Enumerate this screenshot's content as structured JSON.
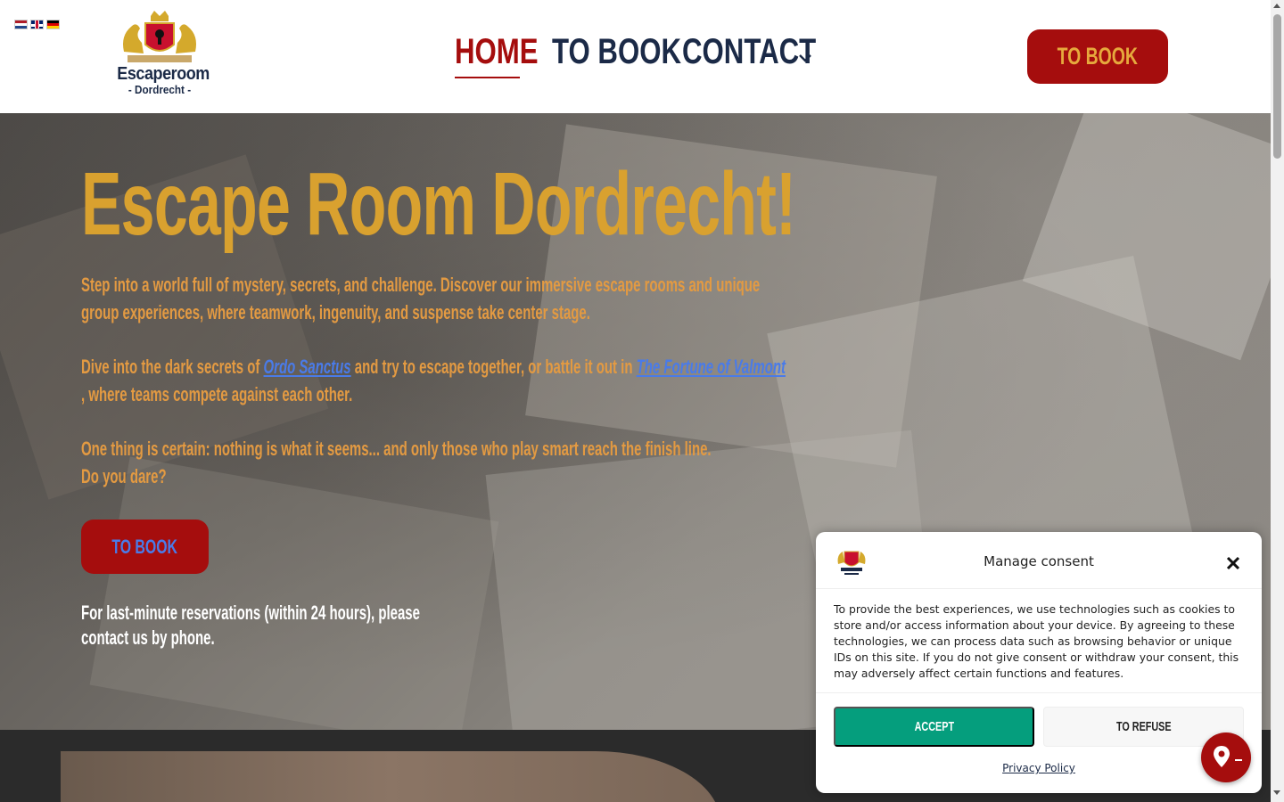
{
  "header": {
    "languages": [
      {
        "code": "nl",
        "icon": "flag-netherlands-icon"
      },
      {
        "code": "en",
        "icon": "flag-uk-icon"
      },
      {
        "code": "de",
        "icon": "flag-germany-icon"
      }
    ],
    "logo": {
      "name": "Escaperoom",
      "city": "- Dordrecht -"
    },
    "nav": [
      {
        "label": "HOME",
        "active": true
      },
      {
        "label": "TO BOOK",
        "active": false
      },
      {
        "label": "CONTACT",
        "active": false,
        "has_dropdown": true
      }
    ],
    "book_button": "TO BOOK"
  },
  "hero": {
    "title": "Escape Room Dordrecht!",
    "para1": "Step into a world full of mystery, secrets, and challenge. Discover our immersive escape rooms and unique group experiences, where teamwork, ingenuity, and suspense take center stage.",
    "para2": {
      "before": "Dive into the dark secrets of ",
      "link1": "Ordo Sanctus",
      "middle": " and try to escape together, or battle it out in ",
      "link2": "The Fortune of Valmont",
      "after": " , where teams compete against each other."
    },
    "para3_line1": "One thing is certain: nothing is what it seems... and only those who play smart reach the finish line.",
    "para3_line2": "Do you dare?",
    "book_button": "TO BOOK",
    "note": "For last-minute reservations (within 24 hours), please contact us by phone."
  },
  "consent": {
    "title": "Manage consent",
    "body": "To provide the best experiences, we use technologies such as cookies to store and/or access information about your device. By agreeing to these technologies, we can process data such as browsing behavior or unique IDs on this site. If you do not give consent or withdraw your consent, this may adversely affect certain functions and features.",
    "accept": "ACCEPT",
    "refuse": "TO REFUSE",
    "privacy": "Privacy Policy"
  },
  "colors": {
    "brand_red": "#a50d0d",
    "gold": "#d9a12f",
    "navy": "#1b2a47",
    "accept_green": "#059e7d",
    "link_blue": "#4a7be8"
  }
}
